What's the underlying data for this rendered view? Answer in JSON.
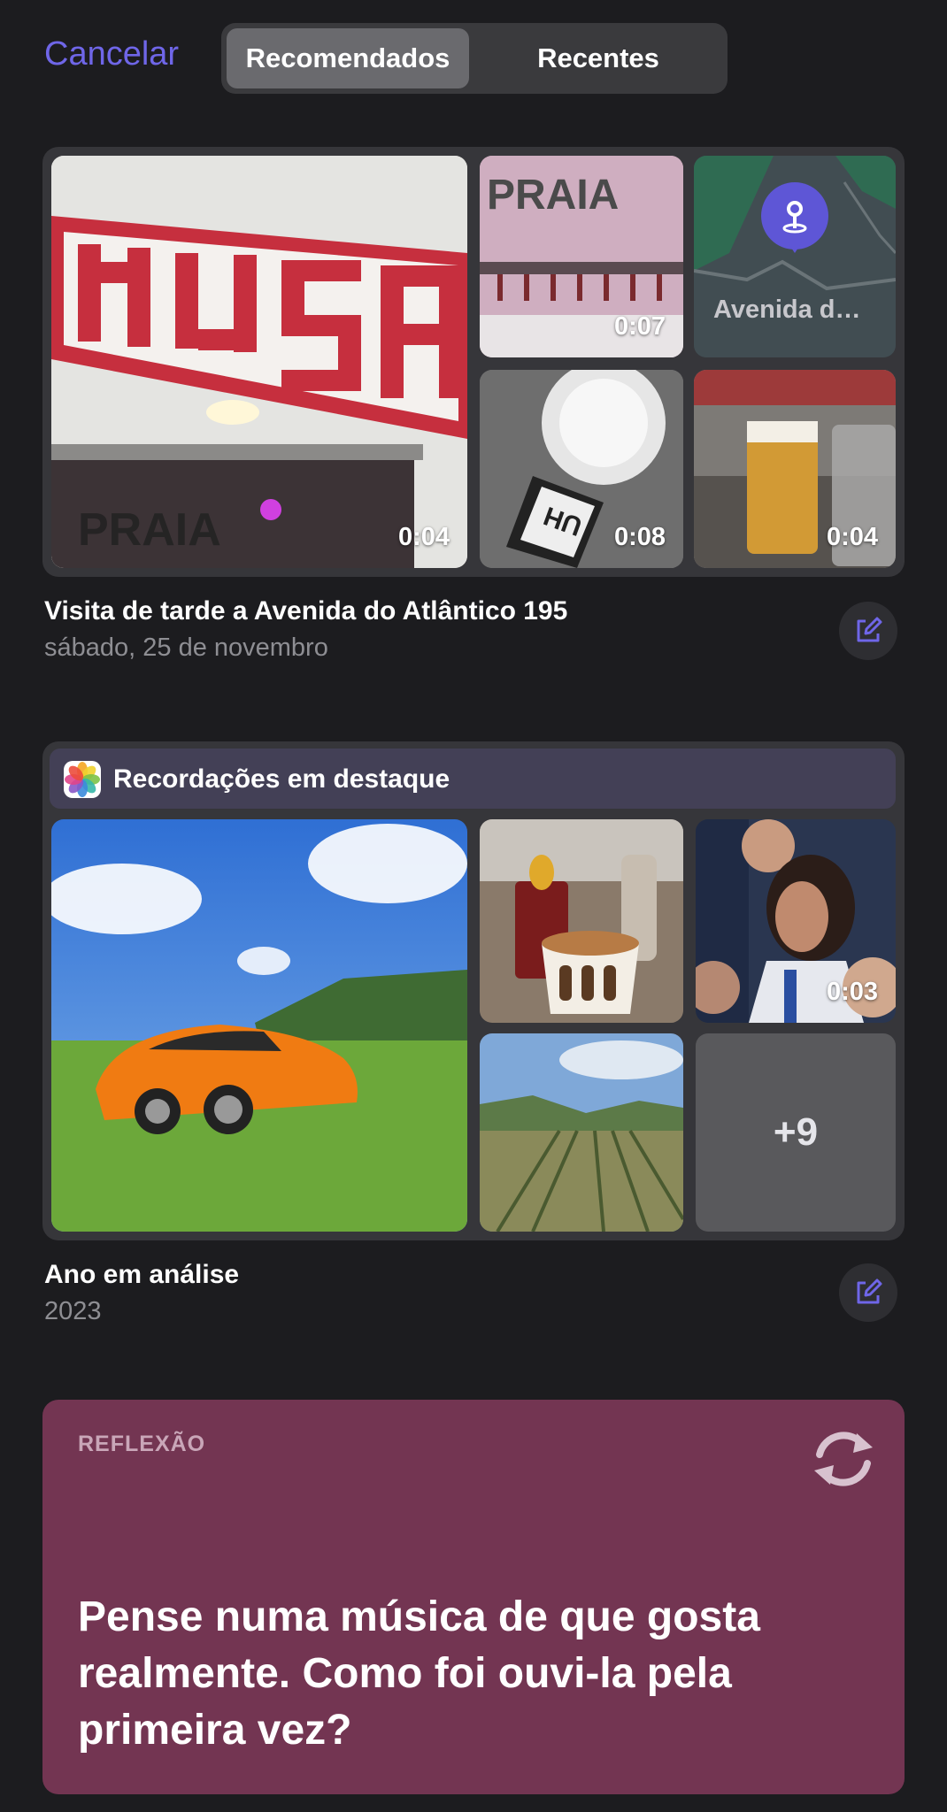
{
  "header": {
    "cancel_label": "Cancelar",
    "tabs": [
      {
        "label": "Recomendados",
        "active": true
      },
      {
        "label": "Recentes",
        "active": false
      }
    ]
  },
  "visit_card": {
    "tiles": [
      {
        "kind": "photo",
        "subject": "MUSA tiled sign on white wall",
        "duration": "0:04"
      },
      {
        "kind": "video",
        "subject": "PRAIA bar taps",
        "duration": "0:07"
      },
      {
        "kind": "map",
        "label": "Avenida d…"
      },
      {
        "kind": "video",
        "subject": "beer glass top view",
        "duration": "0:08"
      },
      {
        "kind": "video",
        "subject": "beer glasses on table",
        "duration": "0:04"
      }
    ],
    "title": "Visita de tarde a Avenida do Atlântico 195",
    "subtitle": "sábado, 25 de novembro"
  },
  "highlights_card": {
    "header_label": "Recordações em destaque",
    "tiles": [
      {
        "kind": "photo",
        "subject": "orange car on grass"
      },
      {
        "kind": "photo",
        "subject": "drinks on cafe table"
      },
      {
        "kind": "video",
        "subject": "woman in crowd",
        "duration": "0:03"
      },
      {
        "kind": "photo",
        "subject": "vineyard hills"
      },
      {
        "kind": "more",
        "label": "+9"
      }
    ],
    "title": "Ano em análise",
    "subtitle": "2023"
  },
  "reflection": {
    "label": "REFLEXÃO",
    "prompt": "Pense numa música de que gosta realmente. Como foi ouvi-la pela primeira vez?"
  },
  "colors": {
    "accent": "#6f66e8",
    "background": "#1c1c1f",
    "reflection_bg": "#733552"
  }
}
